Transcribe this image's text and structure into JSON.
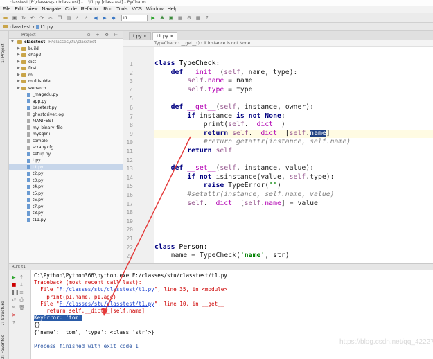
{
  "window": {
    "title": "classtest [F:\\classes\\stu\\classtest] - ...\\t1.py [classtest] - PyCharm"
  },
  "menu": [
    "File",
    "Edit",
    "View",
    "Navigate",
    "Code",
    "Refactor",
    "Run",
    "Tools",
    "VCS",
    "Window",
    "Help"
  ],
  "toolbar": {
    "run_config": "t1"
  },
  "breadcrumb": [
    "classtest",
    "t1.py"
  ],
  "project": {
    "title": "Project",
    "root": "classtest",
    "root_path": "F:\\classes\\stu\\classtest",
    "items": [
      {
        "label": "build",
        "type": "folder",
        "indent": 1
      },
      {
        "label": "chap2",
        "type": "folder",
        "indent": 1
      },
      {
        "label": "dist",
        "type": "folder",
        "indent": 1
      },
      {
        "label": "first",
        "type": "folder",
        "indent": 1
      },
      {
        "label": "m",
        "type": "folder",
        "indent": 1
      },
      {
        "label": "multispider",
        "type": "folder",
        "indent": 1
      },
      {
        "label": "webarch",
        "type": "folder",
        "indent": 1
      },
      {
        "label": "_magedu.py",
        "type": "file",
        "indent": 2
      },
      {
        "label": "app.py",
        "type": "file",
        "indent": 2
      },
      {
        "label": "basetest.py",
        "type": "file",
        "indent": 2
      },
      {
        "label": "ghostdriver.log",
        "type": "txt",
        "indent": 2
      },
      {
        "label": "MANIFEST",
        "type": "txt",
        "indent": 2
      },
      {
        "label": "my_binary_file",
        "type": "txt",
        "indent": 2
      },
      {
        "label": "mysqlini",
        "type": "txt",
        "indent": 2
      },
      {
        "label": "sample",
        "type": "txt",
        "indent": 2
      },
      {
        "label": "scrapy.cfg",
        "type": "txt",
        "indent": 2
      },
      {
        "label": "setup.py",
        "type": "file",
        "indent": 2
      },
      {
        "label": "t.py",
        "type": "file",
        "indent": 2
      },
      {
        "label": "t1.py",
        "type": "file",
        "indent": 2,
        "selected": true
      },
      {
        "label": "t2.py",
        "type": "file",
        "indent": 2
      },
      {
        "label": "t3.py",
        "type": "file",
        "indent": 2
      },
      {
        "label": "t4.py",
        "type": "file",
        "indent": 2
      },
      {
        "label": "t5.py",
        "type": "file",
        "indent": 2
      },
      {
        "label": "t6.py",
        "type": "file",
        "indent": 2
      },
      {
        "label": "t7.py",
        "type": "file",
        "indent": 2
      },
      {
        "label": "t8.py",
        "type": "file",
        "indent": 2
      },
      {
        "label": "t11.py",
        "type": "file",
        "indent": 2
      }
    ]
  },
  "editor": {
    "tabs": [
      "t.py",
      "t1.py"
    ],
    "active_tab": "t1.py",
    "crumbs": "TypeCheck  ›  __get__()  ›  if instance is not None",
    "line_numbers": [
      "1",
      "2",
      "3",
      "4",
      "5",
      "6",
      "7",
      "8",
      "9",
      "10",
      "11",
      "12",
      "13",
      "14",
      "15",
      "16",
      "17",
      "18",
      "19",
      "20",
      "21",
      "22",
      "23",
      "24"
    ],
    "highlight_line": 10
  },
  "run": {
    "title": "Run",
    "config": "t1",
    "output": [
      "C:\\Python\\Python366\\python.exe F:/classes/stu/classtest/t1.py",
      "Traceback (most recent call last):",
      "  File \"F:/classes/stu/classtest/t1.py\", line 35, in <module>",
      "    print(p1.name, p1.age)",
      "  File \"F:/classes/stu/classtest/t1.py\", line 10, in __get__",
      "    return self.__dict__[self.name]",
      "KeyError: 'tom'",
      "{}",
      "{'name': 'tom', 'type': <class 'str'>}",
      "",
      "Process finished with exit code 1"
    ]
  },
  "watermark": "https://blog.csdn.net/qq_42227818",
  "side_tabs": {
    "project": "1: Project",
    "structure": "7: Structure",
    "favorites": "2: Favorites"
  }
}
